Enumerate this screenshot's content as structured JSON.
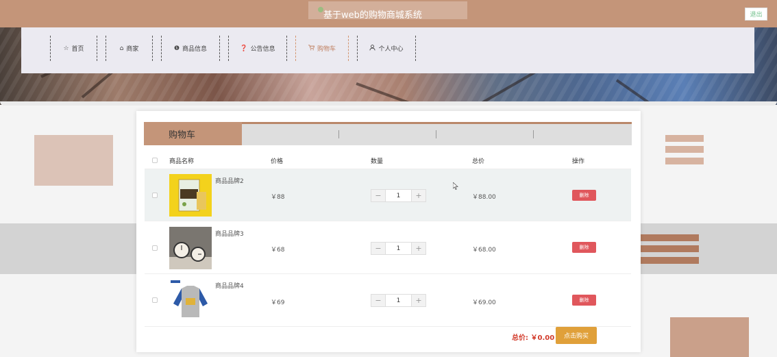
{
  "header": {
    "title": "基于web的购物商城系统",
    "logout_label": "退出"
  },
  "nav": {
    "items": [
      {
        "icon": "☆",
        "label": "首页",
        "active": false
      },
      {
        "icon": "⌂",
        "label": "商家",
        "active": false
      },
      {
        "icon": "❶",
        "label": "商品信息",
        "active": false
      },
      {
        "icon": "❓",
        "label": "公告信息",
        "active": false
      },
      {
        "icon": "🛒",
        "label": "购物车",
        "active": true
      },
      {
        "icon": "⚇",
        "label": "个人中心",
        "active": false
      }
    ]
  },
  "cart": {
    "tab_label": "购物车",
    "columns": [
      "商品名称",
      "价格",
      "数量",
      "总价",
      "操作"
    ],
    "rows": [
      {
        "name": "商品品牌2",
        "price": "￥88",
        "qty": "1",
        "total": "￥88.00",
        "action": "删除",
        "image": "snack-box"
      },
      {
        "name": "商品品牌3",
        "price": "￥68",
        "qty": "1",
        "total": "￥68.00",
        "action": "删除",
        "image": "alarm-clocks"
      },
      {
        "name": "商品品牌4",
        "price": "￥69",
        "qty": "1",
        "total": "￥69.00",
        "action": "删除",
        "image": "kids-shirt"
      }
    ],
    "qty_minus": "−",
    "qty_plus": "+",
    "sum_label": "总价:",
    "sum_value": "￥0.00",
    "buy_label": "点击购买"
  },
  "colors": {
    "accent": "#c49579",
    "delete": "#e0575c",
    "buy": "#e0a03a",
    "sum_text": "#d23a2a"
  }
}
